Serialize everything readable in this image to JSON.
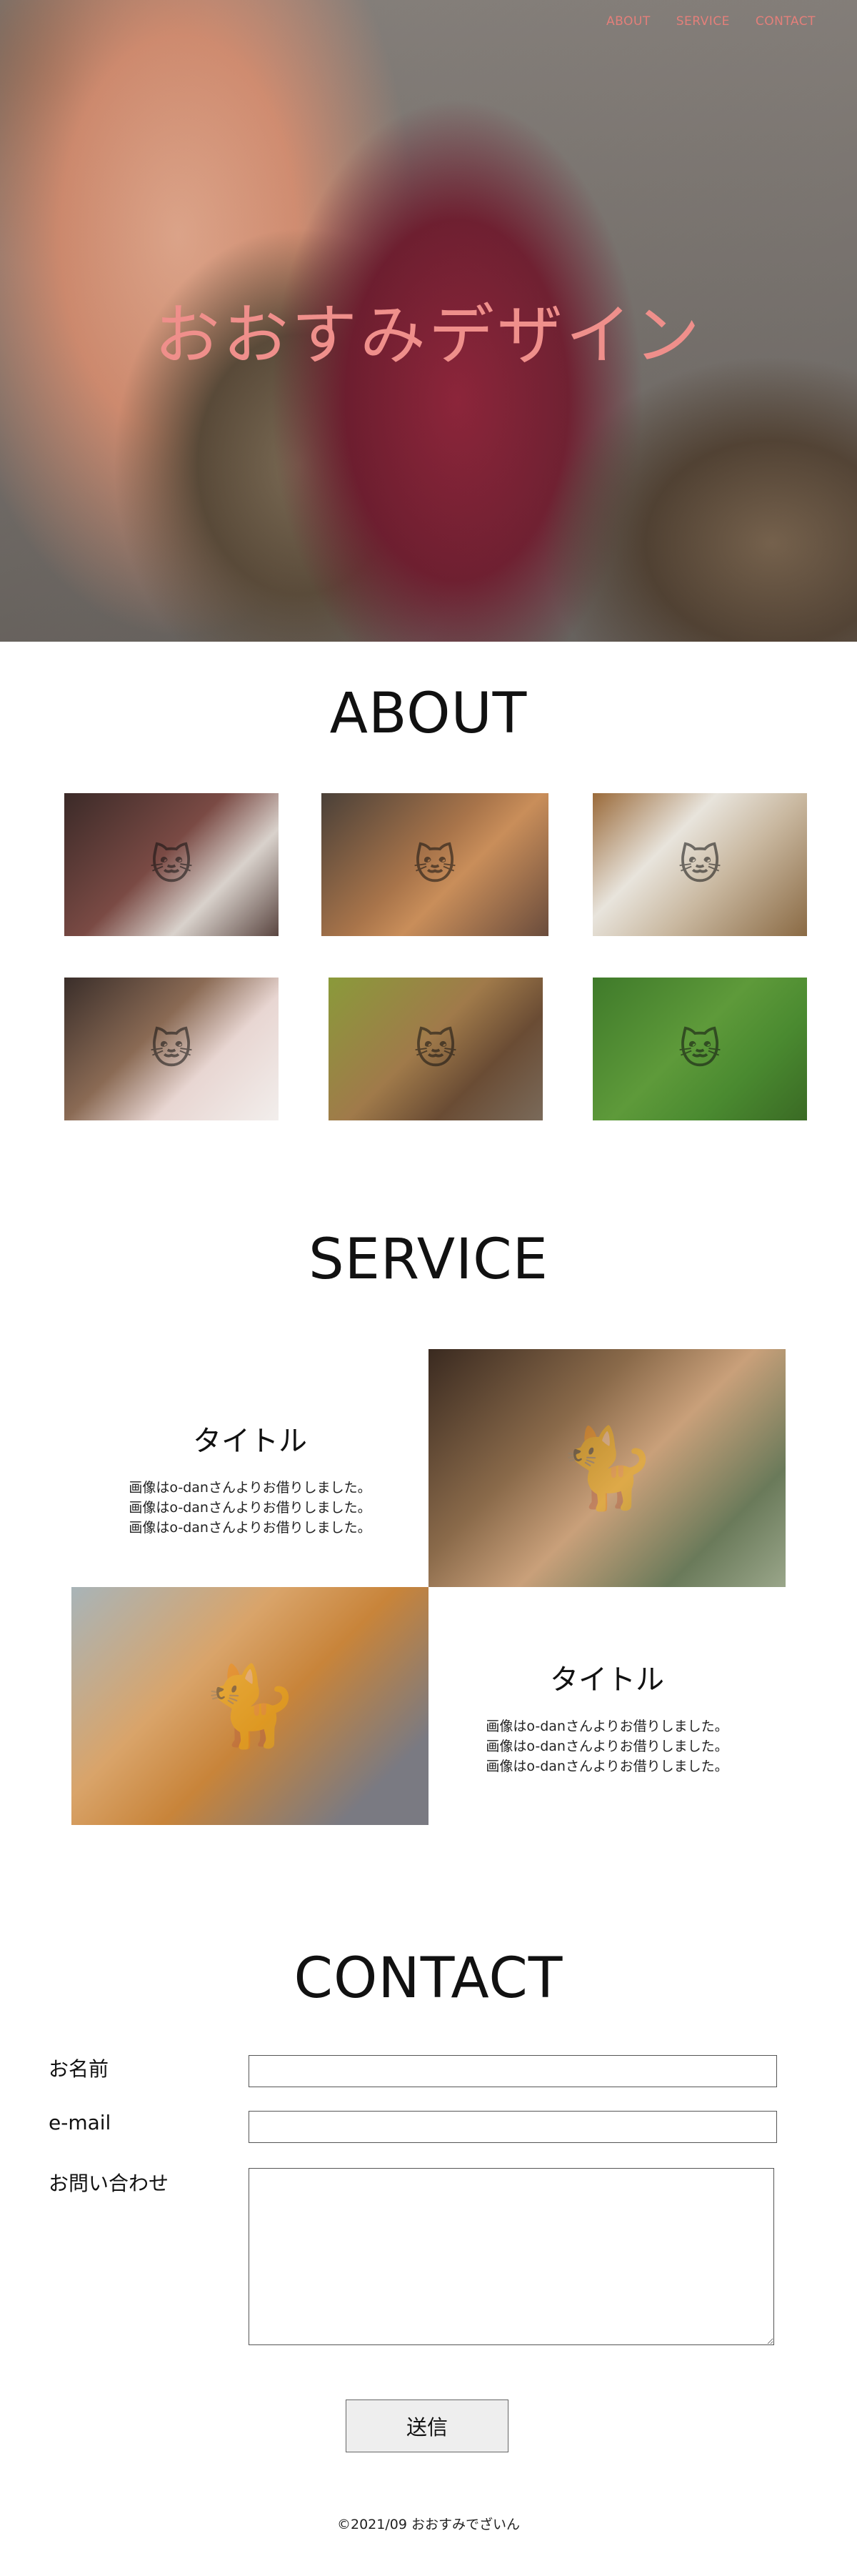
{
  "nav": {
    "items": [
      {
        "label": "ABOUT"
      },
      {
        "label": "SERVICE"
      },
      {
        "label": "CONTACT"
      }
    ]
  },
  "hero": {
    "title": "おおすみデザイン",
    "image_icon": "hand-and-cat-paw-photo"
  },
  "about": {
    "title": "ABOUT",
    "gallery": [
      {
        "icon": "yawning-cat-photo",
        "color": "#5b3a34"
      },
      {
        "icon": "yawning-cat-photo",
        "color": "#7a5a45"
      },
      {
        "icon": "yawning-cat-photo",
        "color": "#8a7a62"
      },
      {
        "icon": "yawning-cat-photo",
        "color": "#6b5448"
      },
      {
        "icon": "yawning-cat-photo",
        "color": "#6d7a3d"
      },
      {
        "icon": "yawning-cat-photo",
        "color": "#4d7a32"
      }
    ]
  },
  "service": {
    "title": "SERVICE",
    "items": [
      {
        "heading": "タイトル",
        "lines": [
          "画像はo-danさんよりお借りしました。",
          "画像はo-danさんよりお借りしました。",
          "画像はo-danさんよりお借りしました。"
        ],
        "icon": "calico-cat-photo"
      },
      {
        "heading": "タイトル",
        "lines": [
          "画像はo-danさんよりお借りしました。",
          "画像はo-danさんよりお借りしました。",
          "画像はo-danさんよりお借りしました。"
        ],
        "icon": "orange-cat-yawning-photo"
      }
    ]
  },
  "contact": {
    "title": "CONTACT",
    "name_label": "お名前",
    "email_label": "e-mail",
    "message_label": "お問い合わせ",
    "submit_label": "送信"
  },
  "footer": {
    "copyright": "©2021/09 おおすみでざいん"
  },
  "colors": {
    "accent": "#ef8f8b",
    "nav": "#e47f7a"
  }
}
